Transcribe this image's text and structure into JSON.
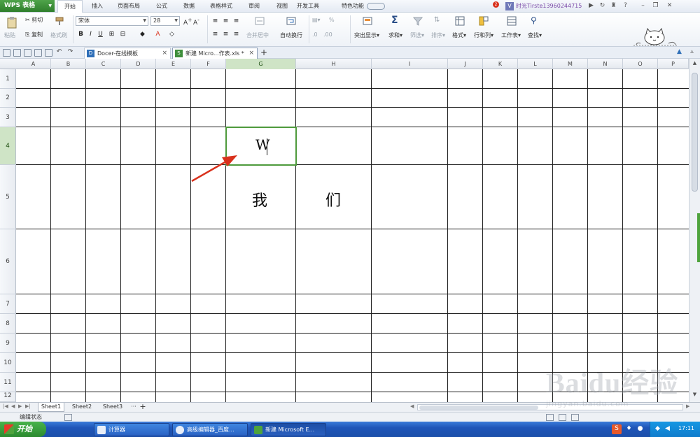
{
  "menubar": {
    "app_button": "WPS 表格",
    "tabs": [
      "开始",
      "插入",
      "页面布局",
      "公式",
      "数据",
      "表格样式",
      "审阅",
      "视图",
      "开发工具",
      "特色功能"
    ],
    "active_tab": "开始",
    "notification_count": "2",
    "user_icon_letter": "V",
    "user_name": "时光Tirste13960244715"
  },
  "ribbon": {
    "paste_label": "粘贴",
    "cut_label": "剪切",
    "copy_label": "复制",
    "format_painter_label": "格式刷",
    "font_name": "宋体",
    "font_size": "28",
    "bold": "B",
    "italic": "I",
    "underline": "U",
    "merge_center_label": "合并居中",
    "wrap_text_label": "自动换行",
    "highlight_label": "突出显示",
    "sum_label": "求和",
    "filter_label": "筛选",
    "sort_label": "排序",
    "format_label": "格式",
    "row_col_label": "行和列",
    "worksheet_label": "工作表",
    "find_label": "查找",
    "percent_label": "%"
  },
  "tabs": {
    "docer_tab": "Docer-在线模板",
    "workbook_tab": "新建 Micro...作表.xls *"
  },
  "grid": {
    "columns": [
      "A",
      "B",
      "C",
      "D",
      "E",
      "F",
      "G",
      "H",
      "I",
      "J",
      "K",
      "L",
      "M",
      "N",
      "O",
      "P"
    ],
    "rows": [
      "1",
      "2",
      "3",
      "4",
      "5",
      "6",
      "7",
      "8",
      "9",
      "10",
      "11",
      "12"
    ],
    "selected_column": "G",
    "selected_row": "4",
    "cells": {
      "G4": "W",
      "G5": "我",
      "H5": "们"
    }
  },
  "sheets": [
    "Sheet1",
    "Sheet2",
    "Sheet3"
  ],
  "active_sheet": "Sheet1",
  "status": {
    "mode": "编辑状态"
  },
  "taskbar": {
    "start_label": "开始",
    "items": [
      "计算器",
      "高级编辑器_百度...",
      "新建 Microsoft E..."
    ],
    "clock": "17:11"
  },
  "watermark": {
    "main": "Baidu经验",
    "sub": "jingyan.baidu.com"
  },
  "colors": {
    "selection_green": "#4e9a3c",
    "arrow_red": "#d9311c",
    "taskbar_blue": "#2a62c4"
  }
}
